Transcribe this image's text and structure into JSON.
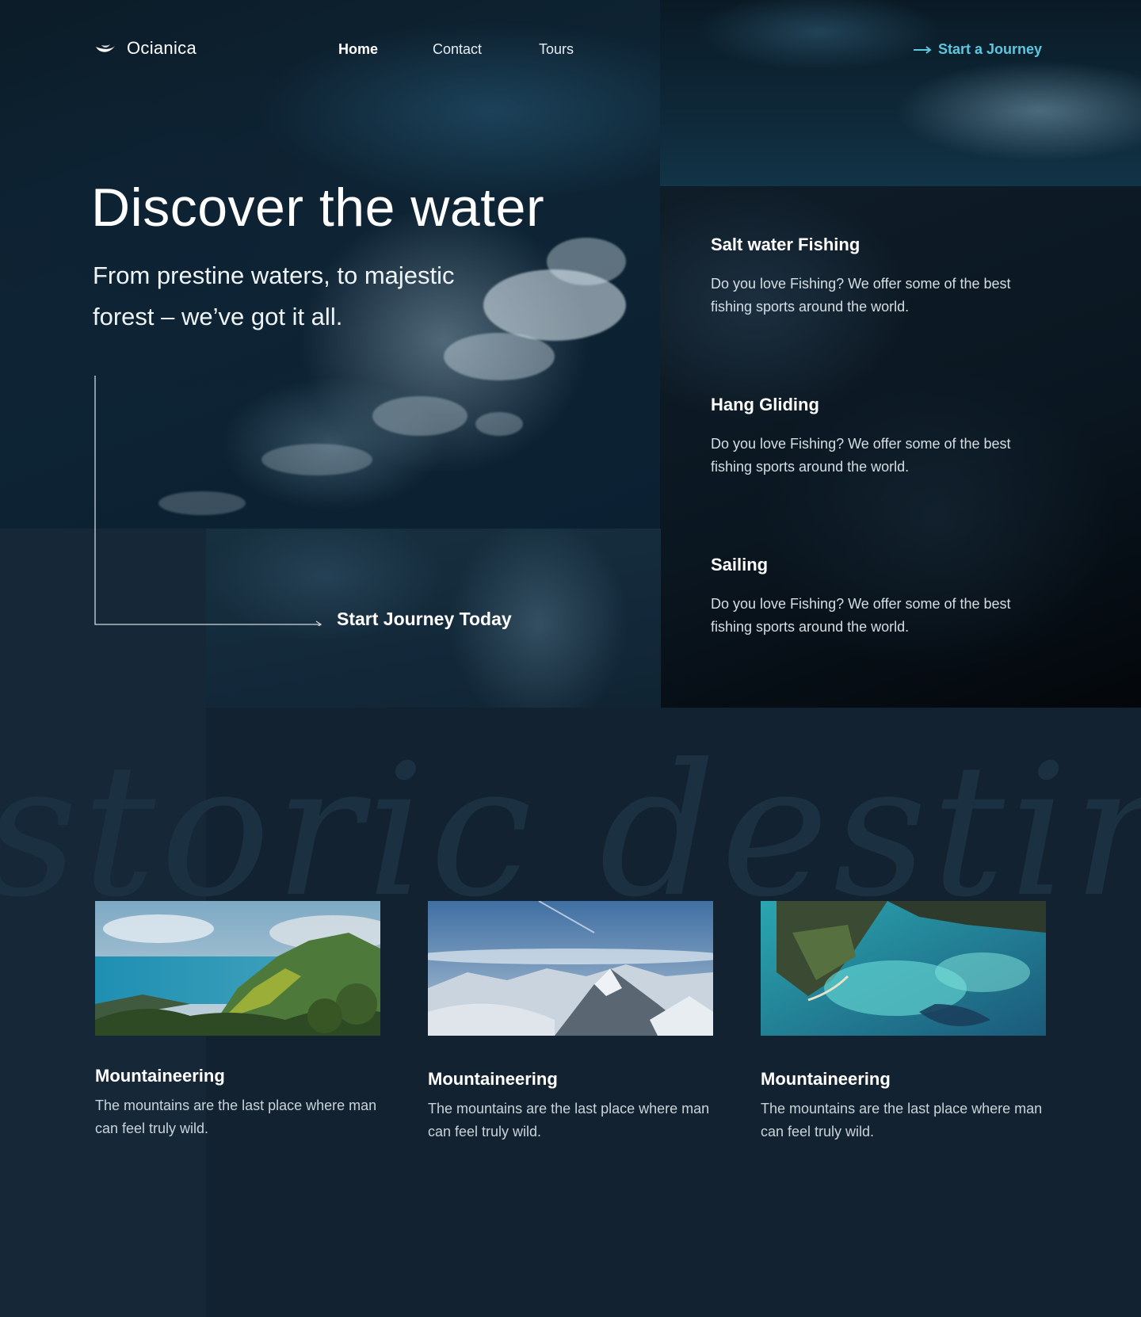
{
  "brand": {
    "name": "Ocianica",
    "logo_icon": "crescent-wave-icon"
  },
  "nav": {
    "links": [
      {
        "label": "Home",
        "active": true
      },
      {
        "label": "Contact",
        "active": false
      },
      {
        "label": "Tours",
        "active": false
      }
    ],
    "cta_label": "Start a Journey",
    "cta_icon": "arrow-right-icon"
  },
  "hero": {
    "title": "Discover the water",
    "subtitle": "From prestine waters, to majestic forest – we’ve got it all.",
    "cta_label": "Start Journey Today"
  },
  "services": [
    {
      "title": "Salt water Fishing",
      "description": "Do you love Fishing? We offer some of the best fishing sports around the world."
    },
    {
      "title": "Hang Gliding",
      "description": "Do you love Fishing? We offer some of the best fishing sports around the world."
    },
    {
      "title": "Sailing",
      "description": "Do you love Fishing? We offer some of the best fishing sports around the world."
    }
  ],
  "section_watermark": "storic destinat",
  "destinations": [
    {
      "title": "Mountaineering",
      "description": "The mountains are the last place where man can feel truly wild.",
      "image": "green-coastal-mountains-photo"
    },
    {
      "title": "Mountaineering",
      "description": "The mountains are the last place where man can feel truly wild.",
      "image": "snowy-peaks-photo"
    },
    {
      "title": "Mountaineering",
      "description": "The mountains are the last place where man can feel truly wild.",
      "image": "island-lagoon-aerial-photo"
    }
  ],
  "colors": {
    "background": "#132230",
    "accent": "#5cc7e0",
    "text": "#ffffff"
  }
}
